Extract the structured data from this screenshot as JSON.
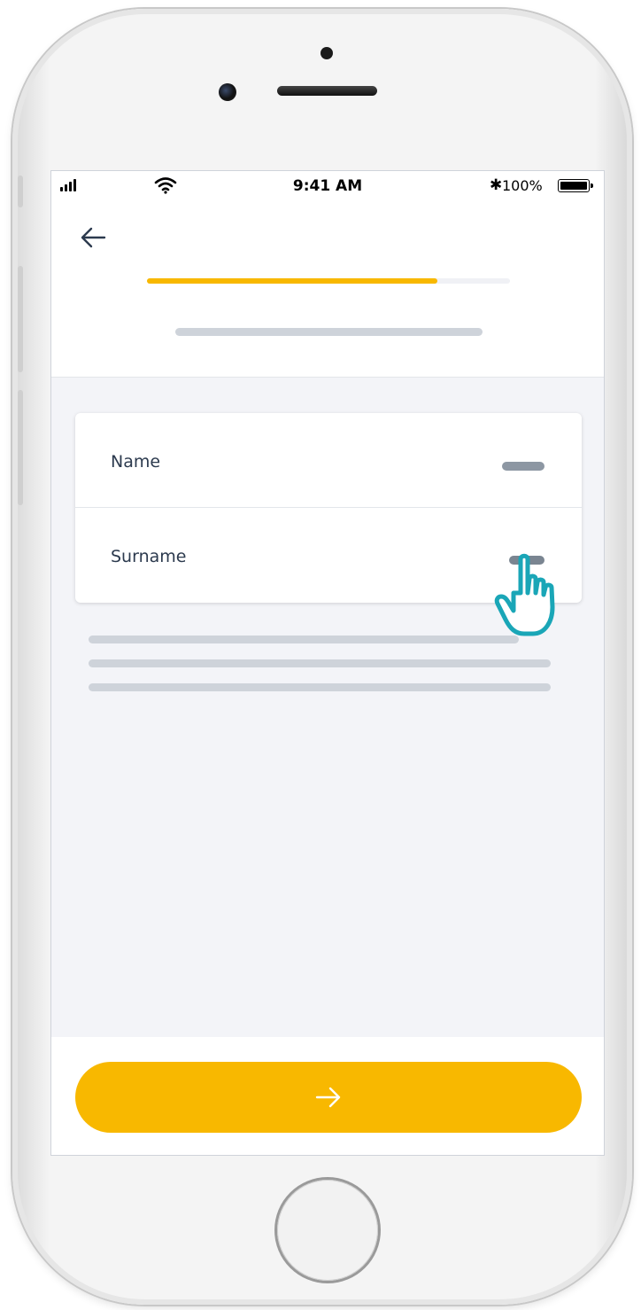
{
  "status_bar": {
    "time": "9:41 AM",
    "battery_percent": "100%",
    "bluetooth_symbol": "✱"
  },
  "progress": {
    "fraction": 0.8
  },
  "form": {
    "fields": [
      {
        "label": "Name"
      },
      {
        "label": "Surname"
      }
    ]
  },
  "colors": {
    "accent": "#f8b800",
    "hand_outline": "#1aa6b7",
    "background": "#f3f4f8"
  },
  "icons": {
    "back": "arrow-left-icon",
    "next": "arrow-right-icon",
    "pointer": "tap-hand-icon"
  }
}
